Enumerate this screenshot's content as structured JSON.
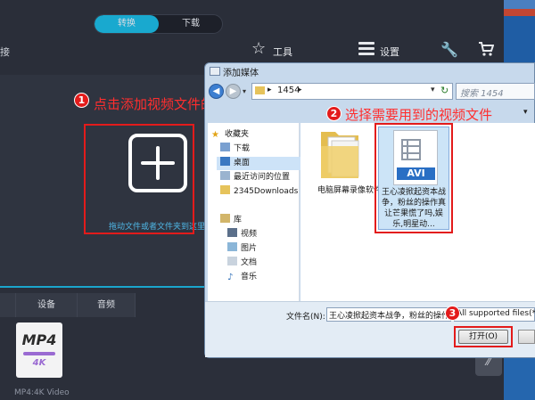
{
  "app": {
    "mode_tabs": [
      {
        "label": "转换",
        "active": true
      },
      {
        "label": "下载",
        "active": false
      }
    ],
    "left_cut_label": "接",
    "toolbar": {
      "tools_label": "工具",
      "settings_label": "设置"
    },
    "drop_hint": "拖动文件或者文件夹到这里",
    "format_tabs": [
      "设备",
      "音频"
    ],
    "format_tile": {
      "title": "MP4",
      "badge": "4K",
      "caption": "MP4:4K Video"
    },
    "icons": [
      "star-tools-icon",
      "menu-settings-icon",
      "wrench-icon",
      "cart-icon",
      "plus-icon",
      "collapse-icon"
    ]
  },
  "annotations": {
    "step1": {
      "num": "1",
      "text": "点击添加视频文件的加号图标"
    },
    "step2": {
      "num": "2",
      "text": "选择需要用到的视频文件"
    },
    "step3": {
      "num": "3"
    },
    "highlight_color": "#e31b1b"
  },
  "dialog": {
    "title": "添加媒体",
    "address": {
      "path": "1454"
    },
    "search_placeholder": "搜索 1454",
    "nav": {
      "favorites": "收藏夹",
      "items": [
        "下载",
        "桌面",
        "最近访问的位置",
        "2345Downloads"
      ],
      "library": "库",
      "library_items": [
        "视频",
        "图片",
        "文档",
        "音乐"
      ]
    },
    "files": [
      {
        "name": "电脑屏幕录像软件",
        "type": "folder"
      },
      {
        "name": "王心凌掀起资本战争，粉丝的操作真让芒果慌了吗,娱乐,明星动...",
        "type": "AVI",
        "selected": true
      }
    ],
    "footer": {
      "filename_label": "文件名(N):",
      "filename_value": "王心凌掀起资本战争，粉丝的操作",
      "filetype_value": "All supported files(*.MP",
      "open_label": "打开(O)"
    }
  }
}
